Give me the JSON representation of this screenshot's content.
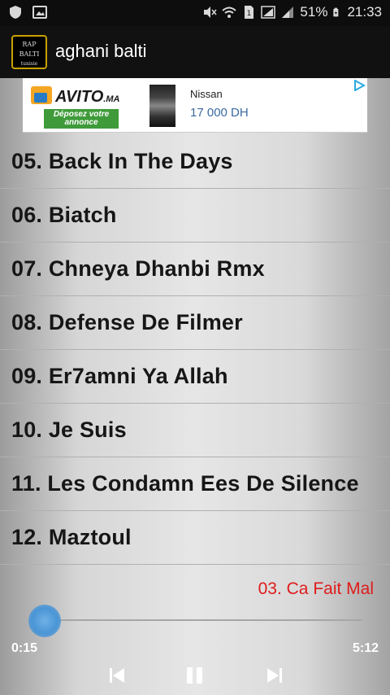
{
  "status_bar": {
    "battery_percent": "51%",
    "time": "21:33",
    "icons": [
      "shield-icon",
      "image-icon",
      "mute-icon",
      "wifi-icon",
      "sim-icon",
      "signal-icon",
      "battery-icon"
    ]
  },
  "app": {
    "title": "aghani balti",
    "logo_text": [
      "RAP",
      "BALTI",
      "tunisie"
    ]
  },
  "ad": {
    "brand": "AVITO",
    "brand_tld": ".MA",
    "deposer": "Déposez votre annonce",
    "item": "Nissan",
    "price": "17 000 DH"
  },
  "tracks": [
    "05. Back In The Days",
    "06. Biatch",
    "07. Chneya Dhanbi Rmx",
    "08. Defense De Filmer",
    "09. Er7amni Ya Allah",
    "10. Je Suis",
    "11. Les Condamn Ees De Silence",
    "12. Maztoul"
  ],
  "player": {
    "now_playing": "03. Ca Fait Mal",
    "current_time": "0:15",
    "total_time": "5:12",
    "progress": 0.05,
    "accent_color": "#4a95d6",
    "now_playing_color": "#e01b1b"
  }
}
